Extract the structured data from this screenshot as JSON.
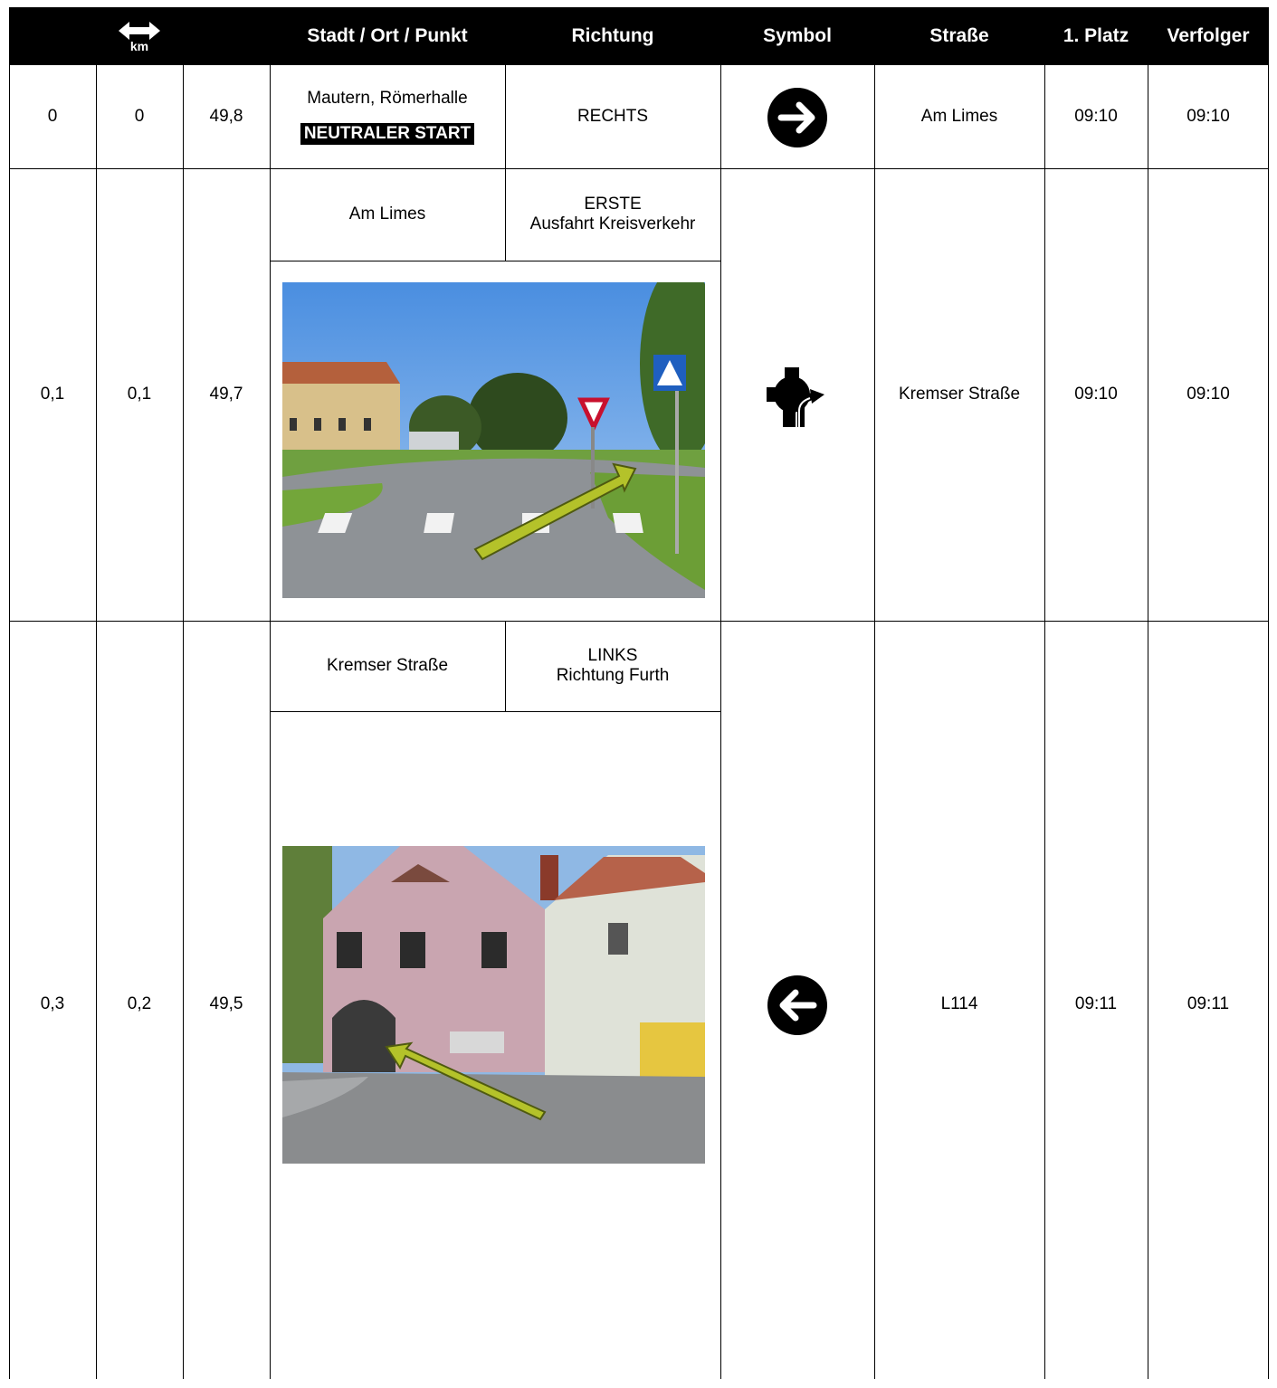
{
  "header": {
    "col_icon_label": "km",
    "col_place": "Stadt / Ort / Punkt",
    "col_direction": "Richtung",
    "col_symbol": "Symbol",
    "col_street": "Straße",
    "col_first": "1. Platz",
    "col_follower": "Verfolger"
  },
  "rows": [
    {
      "km_total": "0",
      "km_partial": "0",
      "km_remaining": "49,8",
      "place": "Mautern, Römerhalle",
      "place_badge": "NEUTRALER START",
      "direction_line1": "RECHTS",
      "direction_line2": "",
      "symbol": "arrow-right-circle-icon",
      "street": "Am Limes",
      "time_first": "09:10",
      "time_follower": "09:10"
    },
    {
      "km_total": "0,1",
      "km_partial": "0,1",
      "km_remaining": "49,7",
      "place": "Am Limes",
      "direction_line1": "ERSTE",
      "direction_line2": "Ausfahrt Kreisverkehr",
      "symbol": "roundabout-first-exit-icon",
      "street": "Kremser Straße",
      "time_first": "09:10",
      "time_follower": "09:10"
    },
    {
      "km_total": "0,3",
      "km_partial": "0,2",
      "km_remaining": "49,5",
      "place": "Kremser Straße",
      "direction_line1": "LINKS",
      "direction_line2": "Richtung Furth",
      "symbol": "arrow-left-circle-icon",
      "street": "L114",
      "time_first": "09:11",
      "time_follower": "09:11"
    }
  ],
  "colors": {
    "header_bg": "#000000",
    "arrow_overlay": "#b4c22a",
    "sky": "#6aa6e8"
  }
}
